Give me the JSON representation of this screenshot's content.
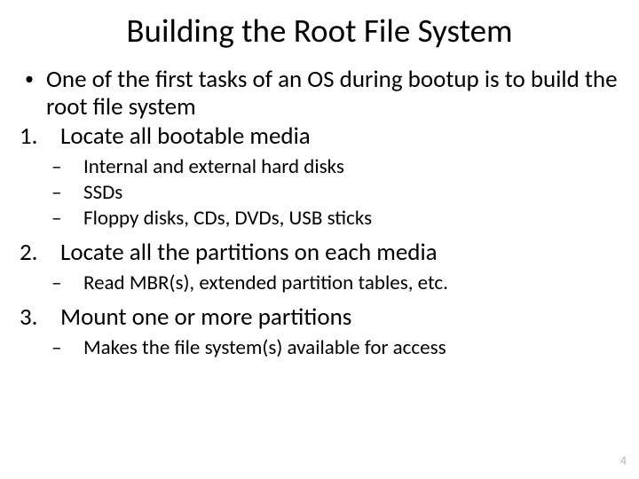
{
  "title": "Building the Root File System",
  "bullet_intro": "One of the first tasks of an OS during bootup is to build the root file system",
  "steps": {
    "s1": {
      "num": "1.",
      "text": "Locate all bootable media",
      "sub": [
        "Internal and external hard disks",
        "SSDs",
        "Floppy disks, CDs, DVDs, USB sticks"
      ]
    },
    "s2": {
      "num": "2.",
      "text": "Locate all the partitions on each media",
      "sub": [
        "Read MBR(s), extended partition tables, etc."
      ]
    },
    "s3": {
      "num": "3.",
      "text": "Mount one or more partitions",
      "sub": [
        "Makes the file system(s) available for access"
      ]
    }
  },
  "dash": "–",
  "bullet_dot": "•",
  "page_number": "4"
}
